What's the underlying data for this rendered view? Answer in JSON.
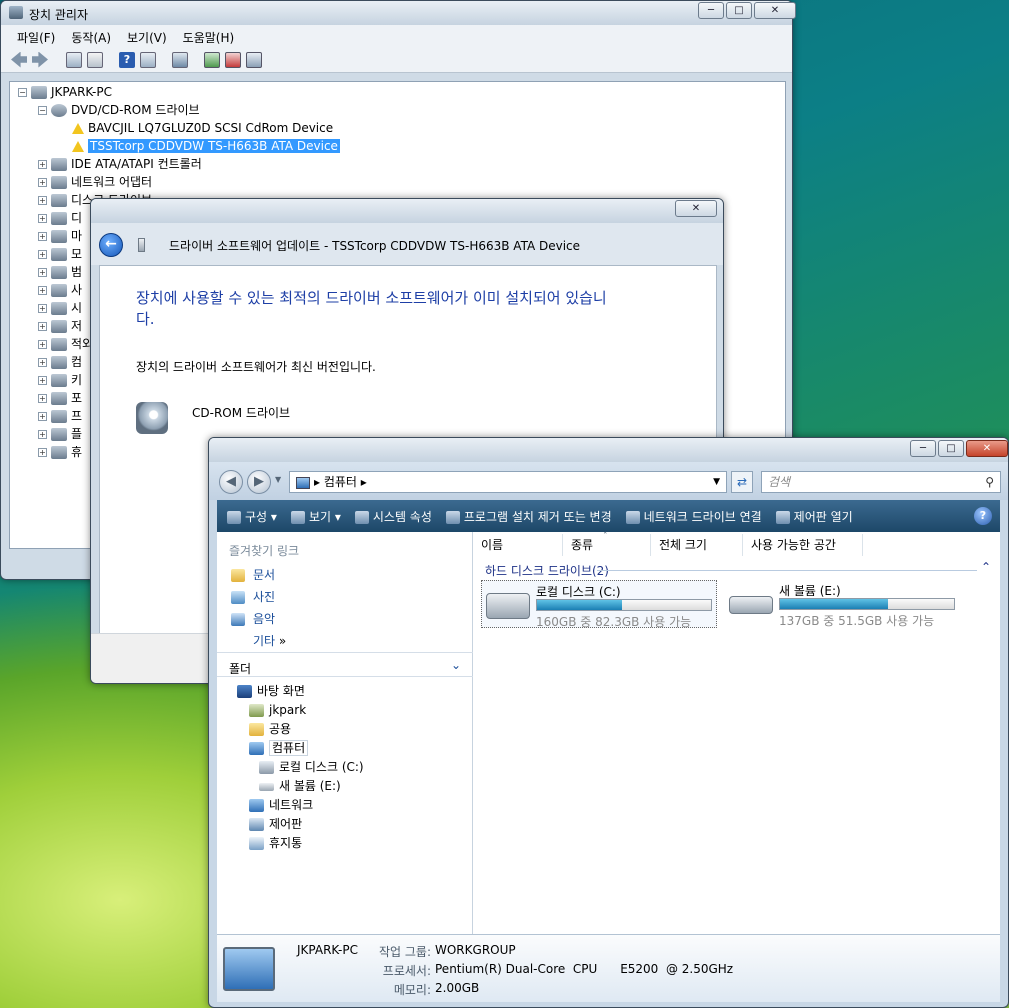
{
  "device_manager": {
    "title": "장치 관리자",
    "menu": [
      "파일(F)",
      "동작(A)",
      "보기(V)",
      "도움말(H)"
    ],
    "tree": [
      {
        "label": "JKPARK-PC"
      },
      {
        "label": "DVD/CD-ROM 드라이브"
      },
      {
        "label": "BAVCJIL LQ7GLUZ0D SCSI CdRom Device"
      },
      {
        "label": "TSSTcorp CDDVDW TS-H663B ATA Device"
      },
      {
        "label": "IDE ATA/ATAPI 컨트롤러"
      },
      {
        "label": "네트워크 어댑터"
      },
      {
        "label": "디스크 드라이브"
      },
      {
        "label": "디"
      },
      {
        "label": "마"
      },
      {
        "label": "모"
      },
      {
        "label": "범"
      },
      {
        "label": "사"
      },
      {
        "label": "시"
      },
      {
        "label": "저"
      },
      {
        "label": "적외"
      },
      {
        "label": "컴"
      },
      {
        "label": "키"
      },
      {
        "label": "포"
      },
      {
        "label": "프"
      },
      {
        "label": "플"
      },
      {
        "label": "휴"
      }
    ]
  },
  "driver_dialog": {
    "title": "드라이버 소프트웨어 업데이트 - TSSTcorp CDDVDW TS-H663B ATA Device",
    "heading_line1": "장치에 사용할 수 있는 최적의 드라이버 소프트웨어가 이미 설치되어 있습니",
    "heading_line2": "다.",
    "message": "장치의 드라이버 소프트웨어가 최신 버전입니다.",
    "device_label": "CD-ROM 드라이브"
  },
  "explorer": {
    "address": "컴퓨터",
    "search_placeholder": "검색",
    "commands": [
      "구성",
      "보기",
      "시스템 속성",
      "프로그램 설치 제거 또는 변경",
      "네트워크 드라이브 연결",
      "제어판 열기"
    ],
    "favorites_title": "즐겨찾기 링크",
    "favorites": [
      "문서",
      "사진",
      "음악"
    ],
    "more_label": "기타",
    "folders_title": "폴더",
    "folder_tree": [
      "바탕 화면",
      "jkpark",
      "공용",
      "컴퓨터",
      "로컬 디스크 (C:)",
      "새 볼륨 (E:)",
      "네트워크",
      "제어판",
      "휴지통"
    ],
    "columns": [
      "이름",
      "종류",
      "전체 크기",
      "사용 가능한 공간"
    ],
    "group_label": "하드 디스크 드라이브(2)",
    "drives": [
      {
        "name": "로컬 디스크 (C:)",
        "free_text": "160GB 중 82.3GB 사용 가능",
        "used_fraction": 0.49
      },
      {
        "name": "새 볼륨 (E:)",
        "free_text": "137GB 중 51.5GB 사용 가능",
        "used_fraction": 0.62
      }
    ],
    "details": {
      "computer_name": "JKPARK-PC",
      "workgroup_label": "작업 그룹:",
      "workgroup": "WORKGROUP",
      "processor_label": "프로세서:",
      "processor": "Pentium(R) Dual-Core  CPU      E5200  @ 2.50GHz",
      "memory_label": "메모리:",
      "memory": "2.00GB"
    }
  }
}
